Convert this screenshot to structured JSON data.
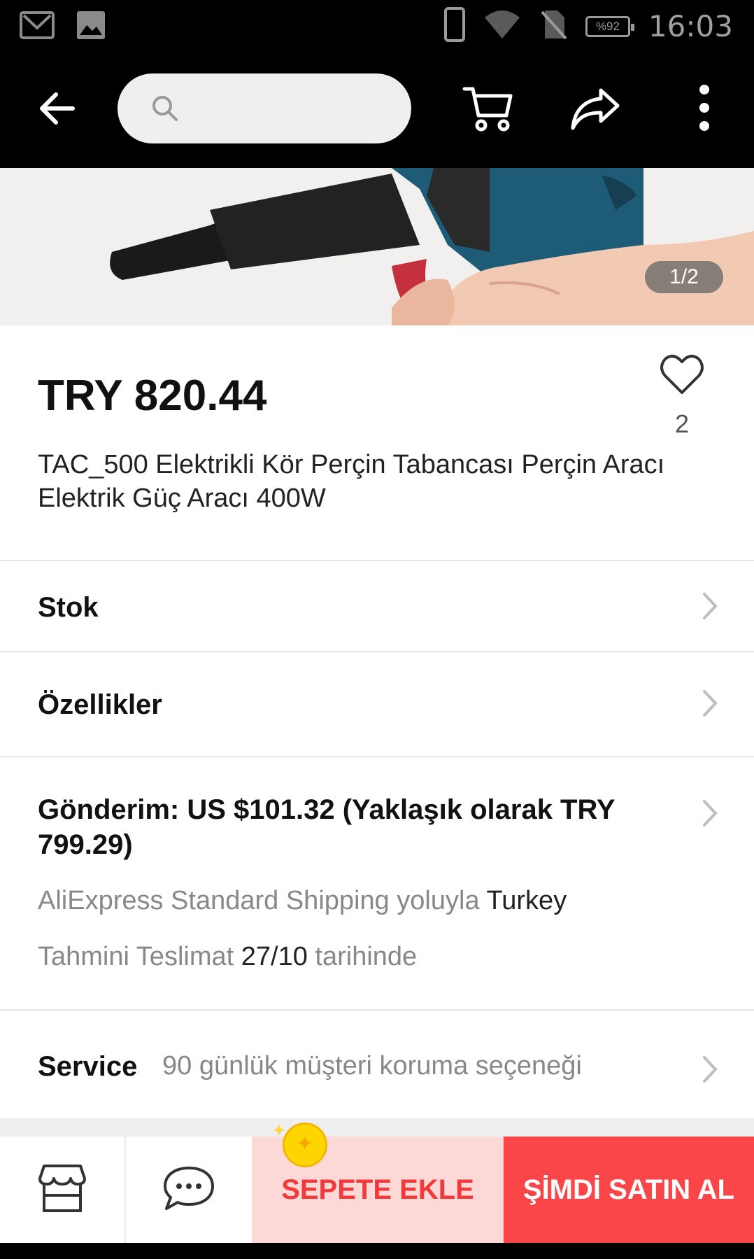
{
  "status_bar": {
    "battery": "%92",
    "time": "16:03"
  },
  "search": {
    "placeholder": "",
    "value": ""
  },
  "product": {
    "image_pager": "1/2",
    "price": "TRY 820.44",
    "wishlist_count": "2",
    "title": "TAC_500 Elektrikli Kör Perçin Tabancası Perçin Aracı Elektrik Güç Aracı 400W"
  },
  "sections": {
    "stock_label": "Stok",
    "features_label": "Özellikler",
    "shipping_title": "Gönderim: US $101.32 (Yaklaşık olarak TRY 799.29)",
    "shipping_method_prefix": "AliExpress Standard Shipping yoluyla",
    "shipping_destination": "Turkey",
    "delivery_prefix": "Tahmini Teslimat",
    "delivery_date": "27/10",
    "delivery_suffix": "tarihinde",
    "service_label": "Service",
    "service_desc": "90 günlük müşteri koruma seçeneği"
  },
  "actions": {
    "add_to_cart": "SEPETE EKLE",
    "buy_now": "ŞİMDİ SATIN AL"
  },
  "icons": [
    "mail-icon",
    "image-icon",
    "phone-icon",
    "wifi-icon",
    "no-sim-icon",
    "battery-icon",
    "back-arrow-icon",
    "search-icon",
    "cart-icon",
    "share-icon",
    "more-vertical-icon",
    "heart-icon",
    "chevron-right-icon",
    "store-icon",
    "chat-icon",
    "coin-icon"
  ],
  "colors": {
    "accent_red": "#fb4649",
    "cart_bg": "#fcd9d6",
    "cart_text": "#f23a3c"
  }
}
